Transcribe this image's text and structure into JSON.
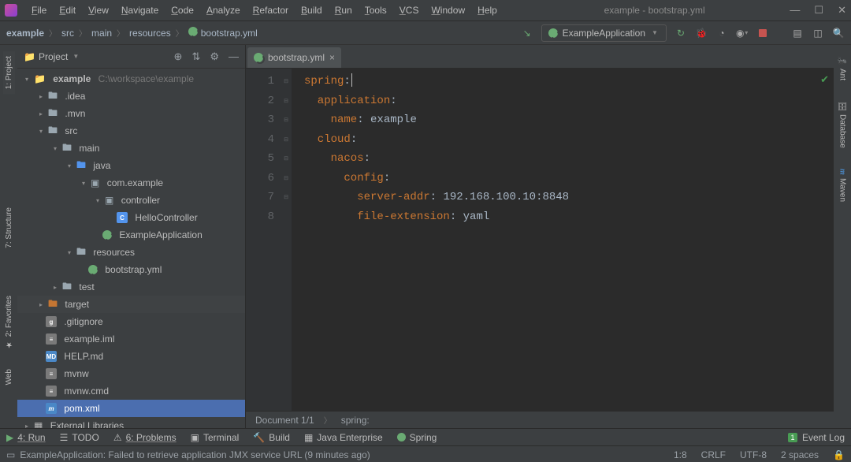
{
  "window_title": "example - bootstrap.yml",
  "menu": [
    "File",
    "Edit",
    "View",
    "Navigate",
    "Code",
    "Analyze",
    "Refactor",
    "Build",
    "Run",
    "Tools",
    "VCS",
    "Window",
    "Help"
  ],
  "breadcrumb": [
    "example",
    "src",
    "main",
    "resources",
    "bootstrap.yml"
  ],
  "run_config": "ExampleApplication",
  "project_title": "Project",
  "tree": {
    "root": {
      "name": "example",
      "path": "C:\\workspace\\example"
    },
    "idea": ".idea",
    "mvn": ".mvn",
    "src": "src",
    "main": "main",
    "java": "java",
    "pkg": "com.example",
    "controller_pkg": "controller",
    "hello": "HelloController",
    "app": "ExampleApplication",
    "resources": "resources",
    "bootstrap": "bootstrap.yml",
    "test": "test",
    "target": "target",
    "gitignore": ".gitignore",
    "iml": "example.iml",
    "help": "HELP.md",
    "mvnw": "mvnw",
    "mvnwcmd": "mvnw.cmd",
    "pom": "pom.xml",
    "ext_libs": "External Libraries"
  },
  "editor": {
    "tab": "bootstrap.yml",
    "lines": [
      "1",
      "2",
      "3",
      "4",
      "5",
      "6",
      "7",
      "8"
    ],
    "tokens": [
      [
        {
          "t": "spring",
          "c": "k"
        },
        {
          "t": ":",
          "c": "w"
        }
      ],
      [
        {
          "t": "  application",
          "c": "k"
        },
        {
          "t": ":",
          "c": "w"
        }
      ],
      [
        {
          "t": "    name",
          "c": "k"
        },
        {
          "t": ": ",
          "c": "w"
        },
        {
          "t": "example",
          "c": "w"
        }
      ],
      [
        {
          "t": "  cloud",
          "c": "k"
        },
        {
          "t": ":",
          "c": "w"
        }
      ],
      [
        {
          "t": "    nacos",
          "c": "k"
        },
        {
          "t": ":",
          "c": "w"
        }
      ],
      [
        {
          "t": "      config",
          "c": "k"
        },
        {
          "t": ":",
          "c": "w"
        }
      ],
      [
        {
          "t": "        server-addr",
          "c": "k"
        },
        {
          "t": ": ",
          "c": "w"
        },
        {
          "t": "192.168.100.10:8848",
          "c": "w"
        }
      ],
      [
        {
          "t": "        file-extension",
          "c": "k"
        },
        {
          "t": ": ",
          "c": "w"
        },
        {
          "t": "yaml",
          "c": "w"
        }
      ]
    ],
    "crumb_doc": "Document 1/1",
    "crumb_path": "spring:"
  },
  "bottom_tabs": {
    "run": "4: Run",
    "todo": "TODO",
    "problems": "6: Problems",
    "terminal": "Terminal",
    "build": "Build",
    "java_ee": "Java Enterprise",
    "spring": "Spring",
    "event_log": "Event Log"
  },
  "status": {
    "msg": "ExampleApplication: Failed to retrieve application JMX service URL (9 minutes ago)",
    "pos": "1:8",
    "le": "CRLF",
    "enc": "UTF-8",
    "indent": "2 spaces"
  },
  "right_tabs": {
    "ant": "Ant",
    "db": "Database",
    "maven": "Maven"
  },
  "left_tabs": {
    "project": "1: Project",
    "structure": "7: Structure",
    "favorites": "2: Favorites",
    "web": "Web"
  }
}
